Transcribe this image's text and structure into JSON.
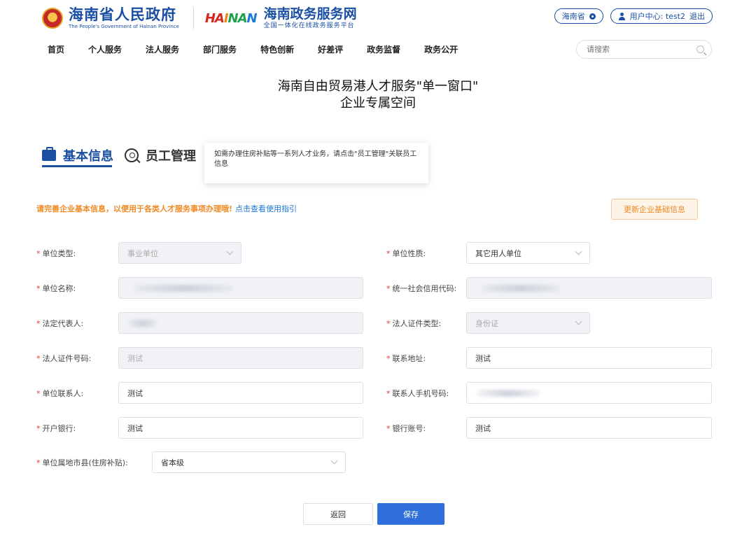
{
  "header": {
    "gov_title": "海南省人民政府",
    "gov_subtitle": "The People's Government of Hainan Province",
    "hainan_logo": [
      "HA",
      "I",
      "NA",
      "N"
    ],
    "service_title": "海南政务服务网",
    "service_subtitle": "全国一体化在线政务服务平台",
    "location": "海南省",
    "user_center": "用户中心: test2",
    "logout": "退出"
  },
  "nav": {
    "items": [
      "首页",
      "个人服务",
      "法人服务",
      "部门服务",
      "特色创新",
      "好差评",
      "政务监督",
      "政务公开"
    ],
    "search_placeholder": "请搜索"
  },
  "page": {
    "title_line1": "海南自由贸易港人才服务\"单一窗口\"",
    "title_line2": "企业专属空间"
  },
  "tabs": [
    {
      "label": "基本信息",
      "active": true
    },
    {
      "label": "员工管理",
      "active": false
    }
  ],
  "tooltip": "如需办理住房补贴等一系列人才业务，请点击\"员工管理\"关联员工信息",
  "notice": {
    "text": "请完善企业基本信息，以便用于各类人才服务事项办理哦!",
    "link": "点击查看使用指引"
  },
  "update_button": "更新企业基础信息",
  "form": {
    "unit_type": {
      "label": "单位类型:",
      "value": "事业单位"
    },
    "unit_nature": {
      "label": "单位性质:",
      "value": "其它用人单位"
    },
    "unit_name": {
      "label": "单位名称:",
      "value": ""
    },
    "credit_code": {
      "label": "统一社会信用代码:",
      "value": ""
    },
    "legal_rep": {
      "label": "法定代表人:",
      "value": ""
    },
    "legal_id_type": {
      "label": "法人证件类型:",
      "value": "身份证"
    },
    "legal_id_no": {
      "label": "法人证件号码:",
      "value": "测试"
    },
    "address": {
      "label": "联系地址:",
      "value": "测试"
    },
    "contact": {
      "label": "单位联系人:",
      "value": "测试"
    },
    "contact_phone": {
      "label": "联系人手机号码:",
      "value": ""
    },
    "bank": {
      "label": "开户银行:",
      "value": "测试"
    },
    "bank_account": {
      "label": "银行账号:",
      "value": "测试"
    },
    "city": {
      "label": "单位属地市县(住房补贴):",
      "value": "省本级"
    }
  },
  "buttons": {
    "back": "返回",
    "save": "保存"
  },
  "colors": {
    "brand_blue": "#1a4fa3",
    "notice_orange": "#f08a24",
    "link_blue": "#1e78d7",
    "primary_button": "#2e6fdb",
    "required_red": "#e53935"
  }
}
